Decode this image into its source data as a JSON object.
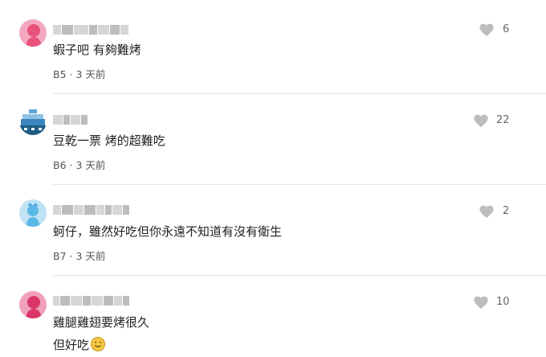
{
  "colors": {
    "like_icon": "#bdbdbd",
    "meta_text": "#555555",
    "divider": "#e6e6e6"
  },
  "comments": [
    {
      "text": "蝦子吧 有夠難烤",
      "floor": "B5",
      "time": "3 天前",
      "likes": "6",
      "avatar_color": "#e8527b"
    },
    {
      "text": "豆乾一票 烤的超難吃",
      "floor": "B6",
      "time": "3 天前",
      "likes": "22",
      "avatar_color": "#1f5d86"
    },
    {
      "text": "蚵仔，雖然好吃但你永遠不知道有沒有衛生",
      "floor": "B7",
      "time": "3 天前",
      "likes": "2",
      "avatar_color": "#5bb8e6"
    },
    {
      "text": "雞腿雞翅要烤很久",
      "text2": "但好吃",
      "likes": "10",
      "avatar_color": "#d9366a"
    }
  ],
  "separator": "·"
}
